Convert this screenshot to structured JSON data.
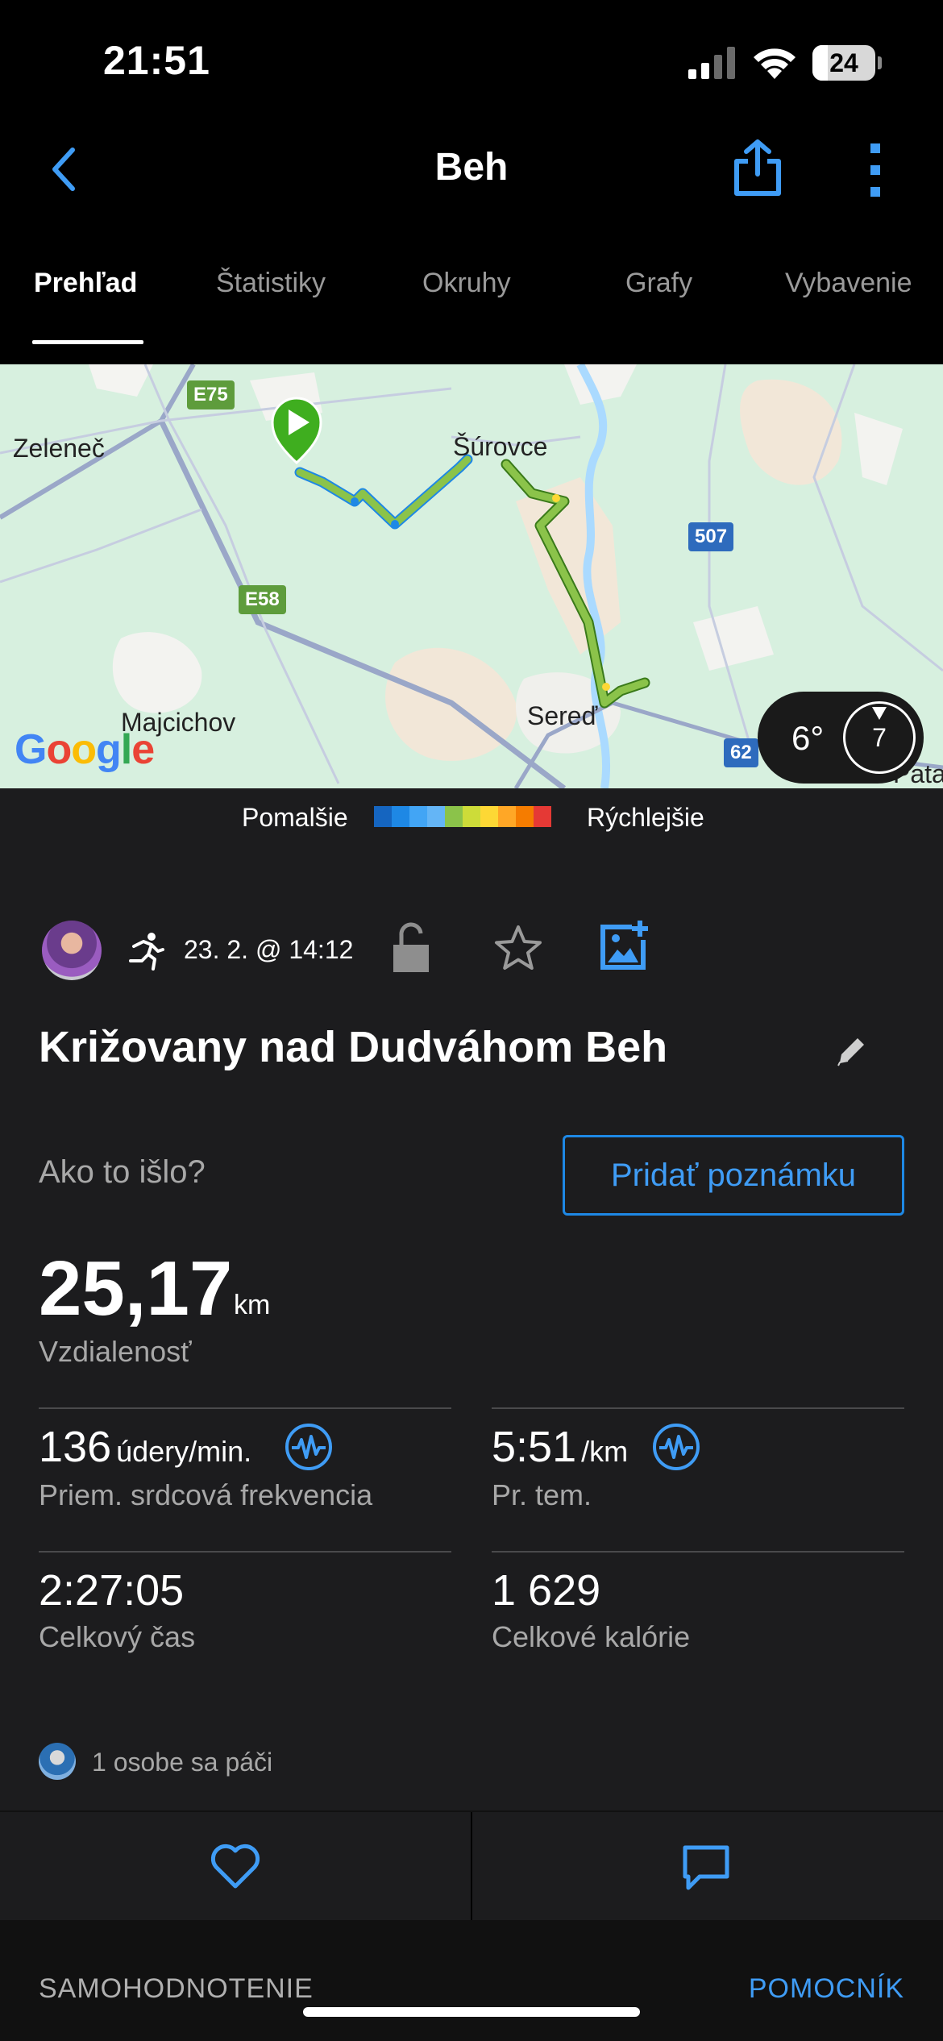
{
  "status_bar": {
    "time": "21:51",
    "battery": "24",
    "battery_level": 0.24
  },
  "header": {
    "title": "Beh",
    "back_icon": "chevron-left-icon",
    "share_icon": "share-icon",
    "more_icon": "more-vertical-icon"
  },
  "tabs": [
    {
      "label": "Prehľad",
      "active": true
    },
    {
      "label": "Štatistiky",
      "active": false
    },
    {
      "label": "Okruhy",
      "active": false
    },
    {
      "label": "Grafy",
      "active": false
    },
    {
      "label": "Vybavenie",
      "active": false
    }
  ],
  "map": {
    "places": [
      "Zeleneč",
      "Šúrovce",
      "Majcichov",
      "Sereď",
      "Pata"
    ],
    "roads": [
      "E75",
      "E58",
      "507",
      "62"
    ],
    "attribution": "Google",
    "weather": {
      "temp": "6°",
      "wind": "7"
    }
  },
  "legend": {
    "slow": "Pomalšie",
    "fast": "Rýchlejšie",
    "colors": [
      "#1565c0",
      "#1e88e5",
      "#42a5f5",
      "#64b5f6",
      "#8bc34a",
      "#cddc39",
      "#fdd835",
      "#ffa726",
      "#f57c00",
      "#e53935"
    ]
  },
  "activity": {
    "date": "23. 2. @ 14:12",
    "title": "Križovany nad Dudváhom Beh",
    "how_prompt": "Ako to išlo?",
    "note_button": "Pridať poznámku",
    "distance": {
      "value": "25,17",
      "unit": "km",
      "label": "Vzdialenosť"
    },
    "stats": [
      {
        "value": "136",
        "unit": "údery/min.",
        "label": "Priem. srdcová frekvencia",
        "icon": "heart-rate-icon"
      },
      {
        "value": "5:51",
        "unit": "/km",
        "label": "Pr. tem.",
        "icon": "pace-chart-icon"
      },
      {
        "value": "2:27:05",
        "unit": "",
        "label": "Celkový čas"
      },
      {
        "value": "1 629",
        "unit": "",
        "label": "Celkové kalórie"
      }
    ],
    "likes": "1 osobe sa páči"
  },
  "footer": {
    "left": "SAMOHODNOTENIE",
    "right": "POMOCNÍK"
  },
  "colors": {
    "accent": "#3f9cf5",
    "background": "#1c1c1e",
    "map": "#d7f0df"
  }
}
